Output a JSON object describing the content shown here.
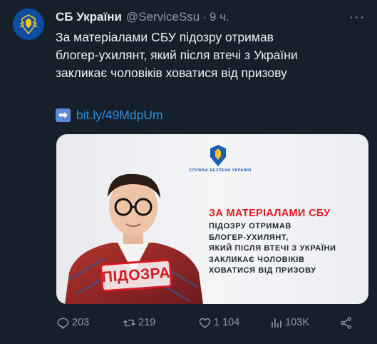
{
  "author": {
    "name": "СБ України",
    "handle": "@ServiceSsu",
    "time": "9 ч."
  },
  "tweet": {
    "text": "За матеріалами СБУ підозру отримав\nблогер-ухилянт, який після втечі з України\nзакликає чоловіків ховатися від призову",
    "link_emoji": "➡",
    "link": "bit.ly/49MdpUm"
  },
  "media": {
    "org": "СЛУЖБА БЕЗПЕКИ УКРАЇНИ",
    "headline": "ЗА МАТЕРІАЛАМИ СБУ",
    "body": "ПІДОЗРУ ОТРИМАВ\nБЛОГЕР-УХИЛЯНТ,\nЯКИЙ ПІСЛЯ ВТЕЧІ З УКРАЇНИ\nЗАКЛИКАЄ ЧОЛОВІКІВ\nХОВАТИСЯ ВІД ПРИЗОВУ",
    "stamp": "ПІДОЗРА"
  },
  "actions": {
    "replies": "203",
    "retweets": "219",
    "likes": "1 104",
    "views": "103K"
  },
  "colors": {
    "background": "#16202b",
    "link": "#2c91e6",
    "accent_red": "#e31b23",
    "brand_blue": "#0b4ea2",
    "muted": "#8b98a5"
  }
}
